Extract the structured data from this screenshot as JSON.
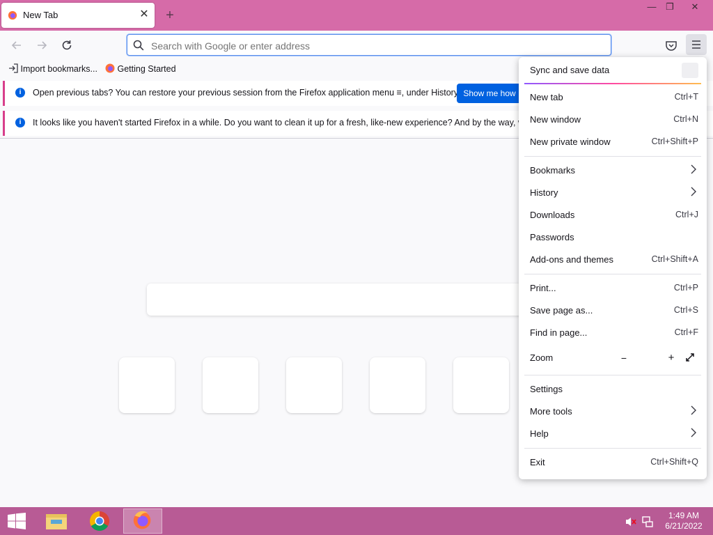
{
  "tab": {
    "title": "New Tab",
    "close": "✕"
  },
  "newtab_symbol": "+",
  "window_controls": [
    "—",
    "❐",
    "✕"
  ],
  "urlbar": {
    "placeholder": "Search with Google or enter address"
  },
  "bookmarks": [
    {
      "label": "Import bookmarks...",
      "icon": "import-icon"
    },
    {
      "label": "Getting Started",
      "icon": "firefox-icon"
    }
  ],
  "notices": [
    {
      "message": "Open previous tabs? You can restore your previous session from the Firefox application menu ≡, under History.",
      "button": "Show me how"
    },
    {
      "message": "It looks like you haven't started Firefox in a while. Do you want to clean it up for a fresh, like-new experience? And by the way, welcom"
    }
  ],
  "menu": {
    "sync": "Sync and save data",
    "items": [
      {
        "label": "New tab",
        "shortcut": "Ctrl+T"
      },
      {
        "label": "New window",
        "shortcut": "Ctrl+N"
      },
      {
        "label": "New private window",
        "shortcut": "Ctrl+Shift+P"
      },
      {
        "label": "Bookmarks"
      },
      {
        "label": "History"
      },
      {
        "label": "Downloads",
        "shortcut": "Ctrl+J"
      },
      {
        "label": "Passwords"
      },
      {
        "label": "Add-ons and themes",
        "shortcut": "Ctrl+Shift+A"
      },
      {
        "label": "Print...",
        "shortcut": "Ctrl+P"
      },
      {
        "label": "Save page as...",
        "shortcut": "Ctrl+S"
      },
      {
        "label": "Find in page...",
        "shortcut": "Ctrl+F"
      },
      {
        "label": "Zoom",
        "minus": "−",
        "plus": "+"
      },
      {
        "label": "Settings"
      },
      {
        "label": "More tools"
      },
      {
        "label": "Help"
      },
      {
        "label": "Exit",
        "shortcut": "Ctrl+Shift+Q"
      }
    ]
  },
  "taskbar": {
    "time": "1:49 AM",
    "date": "6/21/2022"
  },
  "colors": {
    "titlebar": "#d66ba8",
    "taskbar": "#b85b95",
    "accent": "#0061e0"
  }
}
